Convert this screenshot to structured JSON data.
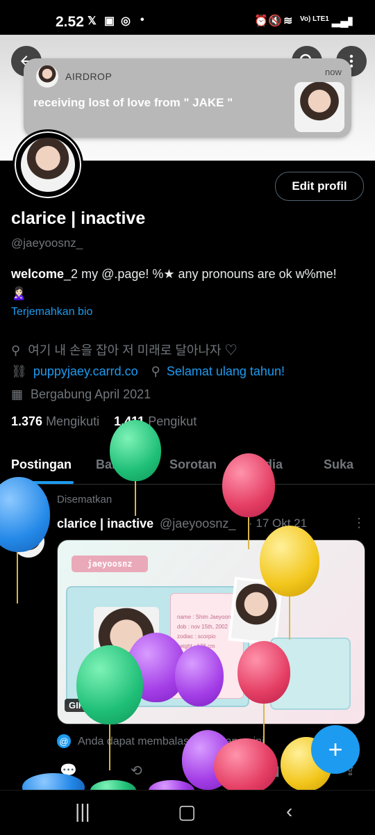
{
  "status": {
    "time": "2.52",
    "icons": [
      "x-icon",
      "news-icon",
      "instagram-icon",
      "dot"
    ],
    "right": "Vo) LTE1"
  },
  "notification": {
    "app": "AIRDROP",
    "message": "receiving lost of love from \" JAKE \"",
    "time": "now"
  },
  "profile": {
    "edit_label": "Edit profil",
    "name": "clarice | inactive",
    "handle": "@jaeyoosnz_",
    "bio_bold": "welcome",
    "bio_rest": "_2 my @.page! %★ any pronouns are ok w%me!",
    "bio_emoji": "🙎🏻‍♀️",
    "translate": "Terjemahkan bio",
    "location": "여기 내 손을 잡아 저 미래로 달아나자 ♡",
    "website": "puppyjaey.carrd.co",
    "birthday": "Selamat ulang tahun!",
    "joined": "Bergabung April 2021",
    "following_count": "1.376",
    "following_label": "Mengikuti",
    "followers_count": "1.411",
    "followers_label": "Pengikut"
  },
  "tabs": [
    "Postingan",
    "Balasan",
    "Sorotan",
    "Media",
    "Suka"
  ],
  "post": {
    "pinned": "Disematkan",
    "name": "clarice | inactive",
    "handle": "@jaeyoosnz_",
    "date": "· 17 Okt 21",
    "media_badge": "GIF",
    "card_title": "jaeyoosnz",
    "card_name": "name : Shim Jaeyoon",
    "card_dob": "dob : nov 15th, 2002",
    "card_zodiac": "zodiac : scorpio",
    "card_height": "height : 176 cm",
    "reply_note": "Anda dapat membalas percakapan ini"
  },
  "colors": {
    "accent": "#1d9bf0",
    "background": "#000000"
  }
}
